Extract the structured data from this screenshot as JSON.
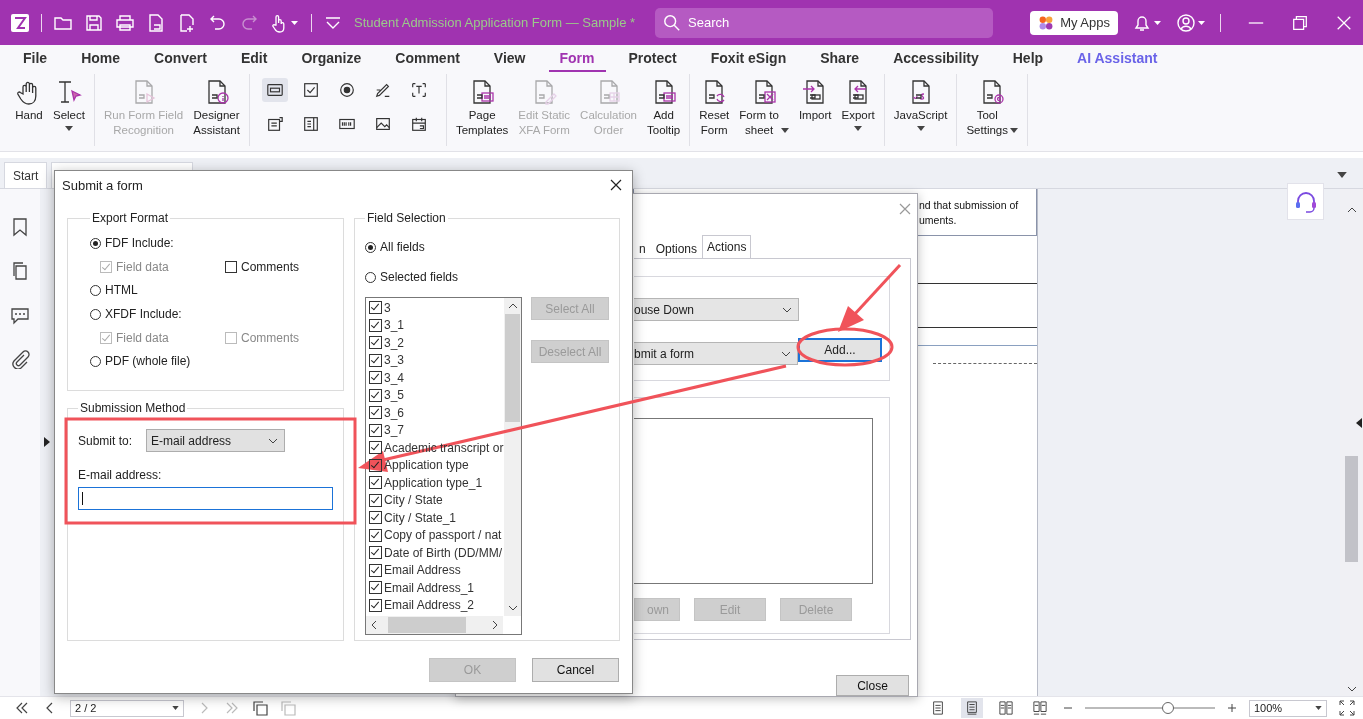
{
  "title_bar": {
    "document_title": "Student Admission Application Form — Sample *",
    "search": {
      "placeholder": "Search"
    },
    "apps_button": "My Apps"
  },
  "menu": [
    {
      "label": "File",
      "selected": false,
      "kind": "plain"
    },
    {
      "label": "Home",
      "selected": false,
      "kind": "plain"
    },
    {
      "label": "Convert",
      "selected": false,
      "kind": "plain"
    },
    {
      "label": "Edit",
      "selected": false,
      "kind": "plain"
    },
    {
      "label": "Organize",
      "selected": false,
      "kind": "plain"
    },
    {
      "label": "Comment",
      "selected": false,
      "kind": "plain"
    },
    {
      "label": "View",
      "selected": false,
      "kind": "plain"
    },
    {
      "label": "Form",
      "selected": true,
      "kind": "plain"
    },
    {
      "label": "Protect",
      "selected": false,
      "kind": "plain"
    },
    {
      "label": "Foxit eSign",
      "selected": false,
      "kind": "plain"
    },
    {
      "label": "Share",
      "selected": false,
      "kind": "plain"
    },
    {
      "label": "Accessibility",
      "selected": false,
      "kind": "plain"
    },
    {
      "label": "Help",
      "selected": false,
      "kind": "plain"
    },
    {
      "label": "AI Assistant",
      "selected": false,
      "kind": "ai"
    }
  ],
  "ribbon": {
    "groups": [
      {
        "kind": "tools",
        "tools": [
          {
            "label": "Hand",
            "kind": "hand",
            "disabled": false,
            "dropdown": false
          },
          {
            "label": "Select",
            "kind": "select",
            "disabled": false,
            "dropdown": true
          }
        ]
      },
      {
        "kind": "tools",
        "tools": [
          {
            "label": "Run Form Field\nRecognition",
            "kind": "run",
            "disabled": true,
            "dropdown": false
          },
          {
            "label": "Designer\nAssistant",
            "kind": "designer",
            "disabled": false,
            "dropdown": false
          }
        ]
      },
      {
        "kind": "fields",
        "fields": [
          {
            "kind": "push-button",
            "selected": true
          },
          {
            "kind": "checkbox",
            "selected": false
          },
          {
            "kind": "radio",
            "selected": false
          },
          {
            "kind": "signature",
            "selected": false
          },
          {
            "kind": "text-field",
            "selected": false
          },
          {
            "kind": "combo-box",
            "selected": false
          },
          {
            "kind": "list-box",
            "selected": false
          },
          {
            "kind": "barcode",
            "selected": false
          },
          {
            "kind": "image",
            "selected": false
          },
          {
            "kind": "date",
            "selected": false
          }
        ]
      },
      {
        "kind": "tools",
        "tools": [
          {
            "label": "Page\nTemplates",
            "kind": "templates",
            "disabled": false,
            "dropdown": false
          },
          {
            "label": "Edit Static\nXFA Form",
            "kind": "edit-xfa",
            "disabled": true,
            "dropdown": false
          },
          {
            "label": "Calculation\nOrder",
            "kind": "calc",
            "disabled": true,
            "dropdown": false
          },
          {
            "label": "Add\nTooltip",
            "kind": "tooltip",
            "disabled": false,
            "dropdown": false
          }
        ]
      },
      {
        "kind": "tools",
        "tools": [
          {
            "label": "Reset\nForm",
            "kind": "reset",
            "disabled": false,
            "dropdown": false
          },
          {
            "label": "Form to\nsheet",
            "kind": "sheet",
            "disabled": false,
            "dropdown": true
          },
          {
            "label": "Import",
            "kind": "import",
            "disabled": false,
            "dropdown": false
          },
          {
            "label": "Export",
            "kind": "export",
            "disabled": false,
            "dropdown": true
          }
        ]
      },
      {
        "kind": "tools",
        "tools": [
          {
            "label": "JavaScript",
            "kind": "js",
            "disabled": false,
            "dropdown": true
          }
        ]
      },
      {
        "kind": "tools",
        "tools": [
          {
            "label": "Tool\nSettings",
            "kind": "settings",
            "disabled": false,
            "dropdown": true
          }
        ]
      }
    ]
  },
  "document_tabs": [
    {
      "label": "Start",
      "selected": false
    }
  ],
  "document": {
    "text": "nd that submission of\numents."
  },
  "properties_dialog": {
    "tabs": [
      {
        "label": "n",
        "selected": false
      },
      {
        "label": "Options",
        "selected": false
      },
      {
        "label": "Actions",
        "selected": true
      }
    ],
    "trigger": "ouse Down",
    "action": "bmit a form",
    "add_button": "Add...",
    "buttons": [
      {
        "label": "own",
        "disabled": true
      },
      {
        "label": "Edit",
        "disabled": true
      },
      {
        "label": "Delete",
        "disabled": true
      }
    ],
    "close_button": "Close"
  },
  "submit_dialog": {
    "title": "Submit a form",
    "export_format": {
      "title": "Export Format",
      "formats": [
        {
          "label": "FDF Include:",
          "selected": true,
          "includes": [
            {
              "label": "Field data",
              "checked": true,
              "disabled": true
            },
            {
              "label": "Comments",
              "checked": false,
              "disabled": false
            }
          ]
        },
        {
          "label": "HTML",
          "selected": false
        },
        {
          "label": "XFDF Include:",
          "selected": false,
          "includes": [
            {
              "label": "Field data",
              "checked": true,
              "disabled": true
            },
            {
              "label": "Comments",
              "checked": false,
              "disabled": true
            }
          ]
        },
        {
          "label": "PDF (whole file)",
          "selected": false
        }
      ]
    },
    "submission_method": {
      "title": "Submission Method",
      "submit_to_label": "Submit to:",
      "submit_to": "E-mail address",
      "address_label": "E-mail address:",
      "address_focused": true
    },
    "field_selection": {
      "title": "Field Selection",
      "scopes": [
        {
          "label": "All fields",
          "selected": true
        },
        {
          "label": "Selected fields",
          "selected": false
        }
      ],
      "fields": [
        {
          "label": "3",
          "checked": true
        },
        {
          "label": "3_1",
          "checked": true
        },
        {
          "label": "3_2",
          "checked": true
        },
        {
          "label": "3_3",
          "checked": true
        },
        {
          "label": "3_4",
          "checked": true
        },
        {
          "label": "3_5",
          "checked": true
        },
        {
          "label": "3_6",
          "checked": true
        },
        {
          "label": "3_7",
          "checked": true
        },
        {
          "label": "Academic transcript or",
          "checked": true
        },
        {
          "label": "Application type",
          "checked": true
        },
        {
          "label": "Application type_1",
          "checked": true
        },
        {
          "label": "City / State",
          "checked": true
        },
        {
          "label": "City / State_1",
          "checked": true
        },
        {
          "label": "Copy of passport / nat",
          "checked": true
        },
        {
          "label": "Date of Birth (DD/MM/",
          "checked": true
        },
        {
          "label": "Email Address",
          "checked": true
        },
        {
          "label": "Email Address_1",
          "checked": true
        },
        {
          "label": "Email Address_2",
          "checked": true
        }
      ],
      "buttons": [
        {
          "label": "Select All",
          "disabled": true
        },
        {
          "label": "Deselect All",
          "disabled": true
        }
      ]
    },
    "buttons": [
      {
        "label": "OK",
        "disabled": true
      },
      {
        "label": "Cancel",
        "disabled": false
      }
    ]
  },
  "status_bar": {
    "page": "2 / 2",
    "view_modes": [
      {
        "kind": "single",
        "selected": false
      },
      {
        "kind": "continuous",
        "selected": true
      },
      {
        "kind": "facing",
        "selected": false
      },
      {
        "kind": "continuous-facing",
        "selected": false
      }
    ],
    "zoom_slider": {
      "level": 0.64
    },
    "zoom": "100%"
  }
}
